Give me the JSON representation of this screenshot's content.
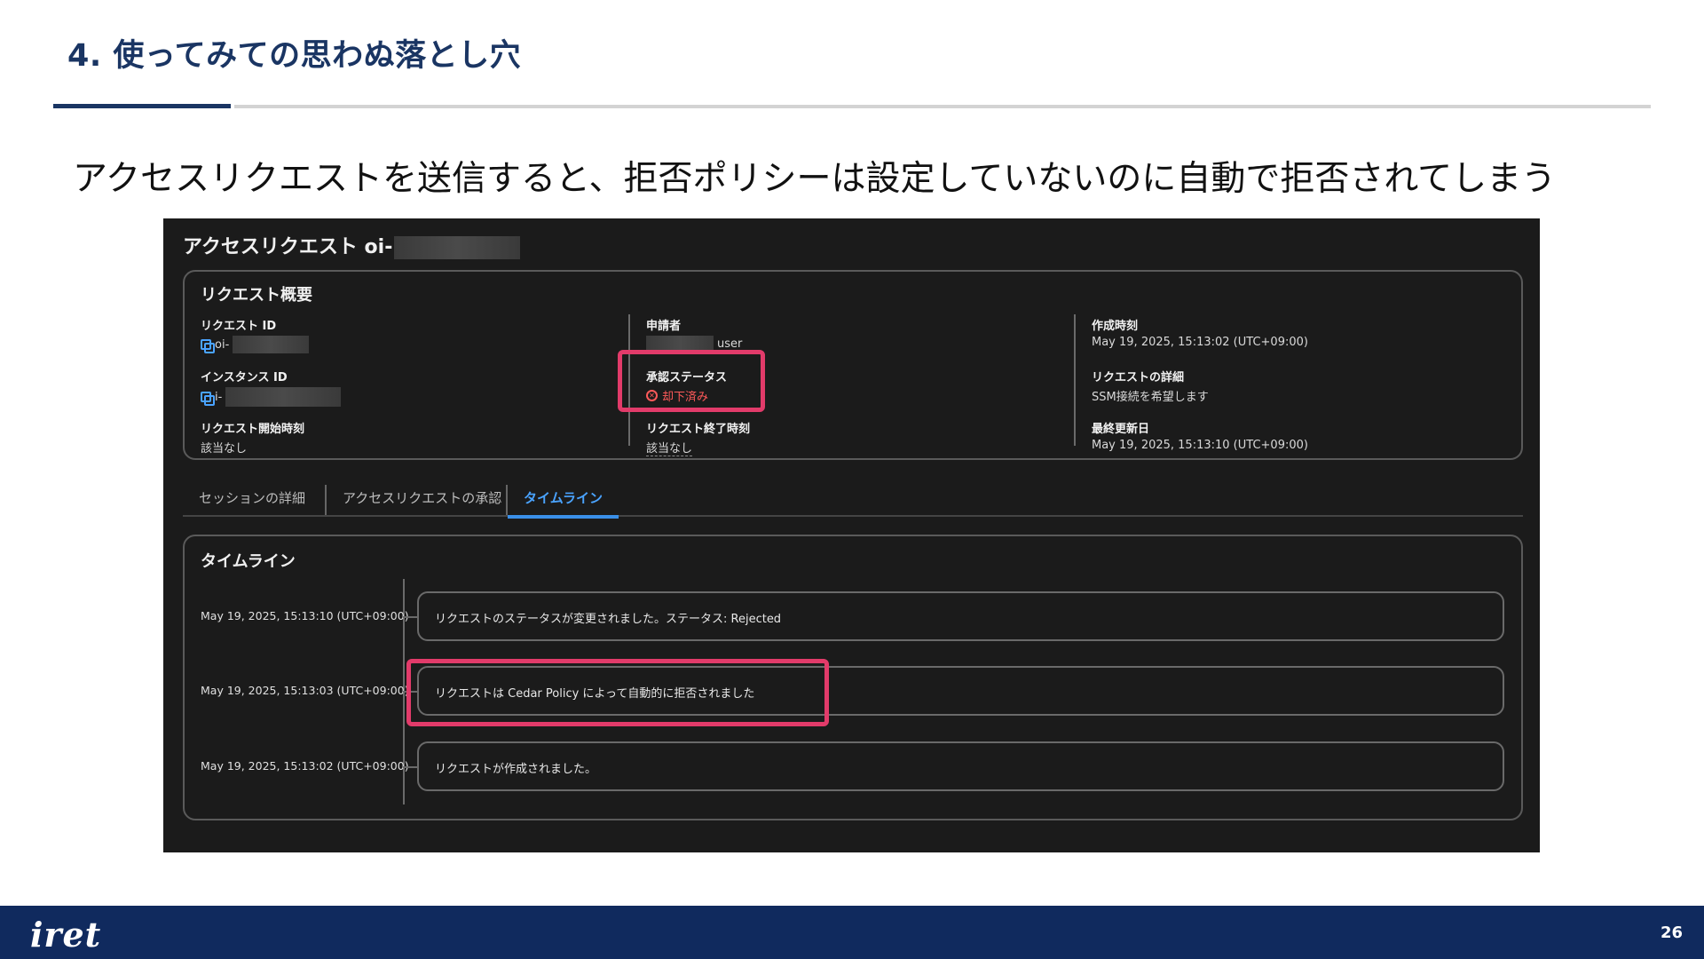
{
  "slide": {
    "title": "4. 使ってみての思わぬ落とし穴",
    "subtitle": "アクセスリクエストを送信すると、拒否ポリシーは設定していないのに自動で拒否されてしまう",
    "page_number": "26",
    "logo": "iret"
  },
  "screenshot": {
    "title_prefix": "アクセスリクエスト oi-",
    "summary": {
      "heading": "リクエスト概要",
      "request_id": {
        "label": "リクエスト ID",
        "value": "oi-"
      },
      "instance_id": {
        "label": "インスタンス ID",
        "value": "i-"
      },
      "start_time": {
        "label": "リクエスト開始時刻",
        "value": "該当なし"
      },
      "requester": {
        "label": "申請者",
        "value": "user"
      },
      "approval_status": {
        "label": "承認ステータス",
        "value": "却下済み"
      },
      "end_time": {
        "label": "リクエスト終了時刻",
        "value": "該当なし"
      },
      "created_at": {
        "label": "作成時刻",
        "value": "May 19, 2025, 15:13:02 (UTC+09:00)"
      },
      "details": {
        "label": "リクエストの詳細",
        "value": "SSM接続を希望します"
      },
      "updated_at": {
        "label": "最終更新日",
        "value": "May 19, 2025, 15:13:10 (UTC+09:00)"
      }
    },
    "tabs": [
      "セッションの詳細",
      "アクセスリクエストの承認",
      "タイムライン"
    ],
    "active_tab": "タイムライン",
    "timeline": {
      "heading": "タイムライン",
      "events": [
        {
          "time": "May 19, 2025, 15:13:10 (UTC+09:00)",
          "message": "リクエストのステータスが変更されました。ステータス: Rejected"
        },
        {
          "time": "May 19, 2025, 15:13:03 (UTC+09:00)",
          "message": "リクエストは Cedar Policy によって自動的に拒否されました"
        },
        {
          "time": "May 19, 2025, 15:13:02 (UTC+09:00)",
          "message": "リクエストが作成されました。"
        }
      ]
    }
  },
  "colors": {
    "brand_navy": "#102a5e",
    "highlight": "#e23b6a",
    "link_blue": "#4aa3ff",
    "rejected_red": "#ff5a5a"
  }
}
